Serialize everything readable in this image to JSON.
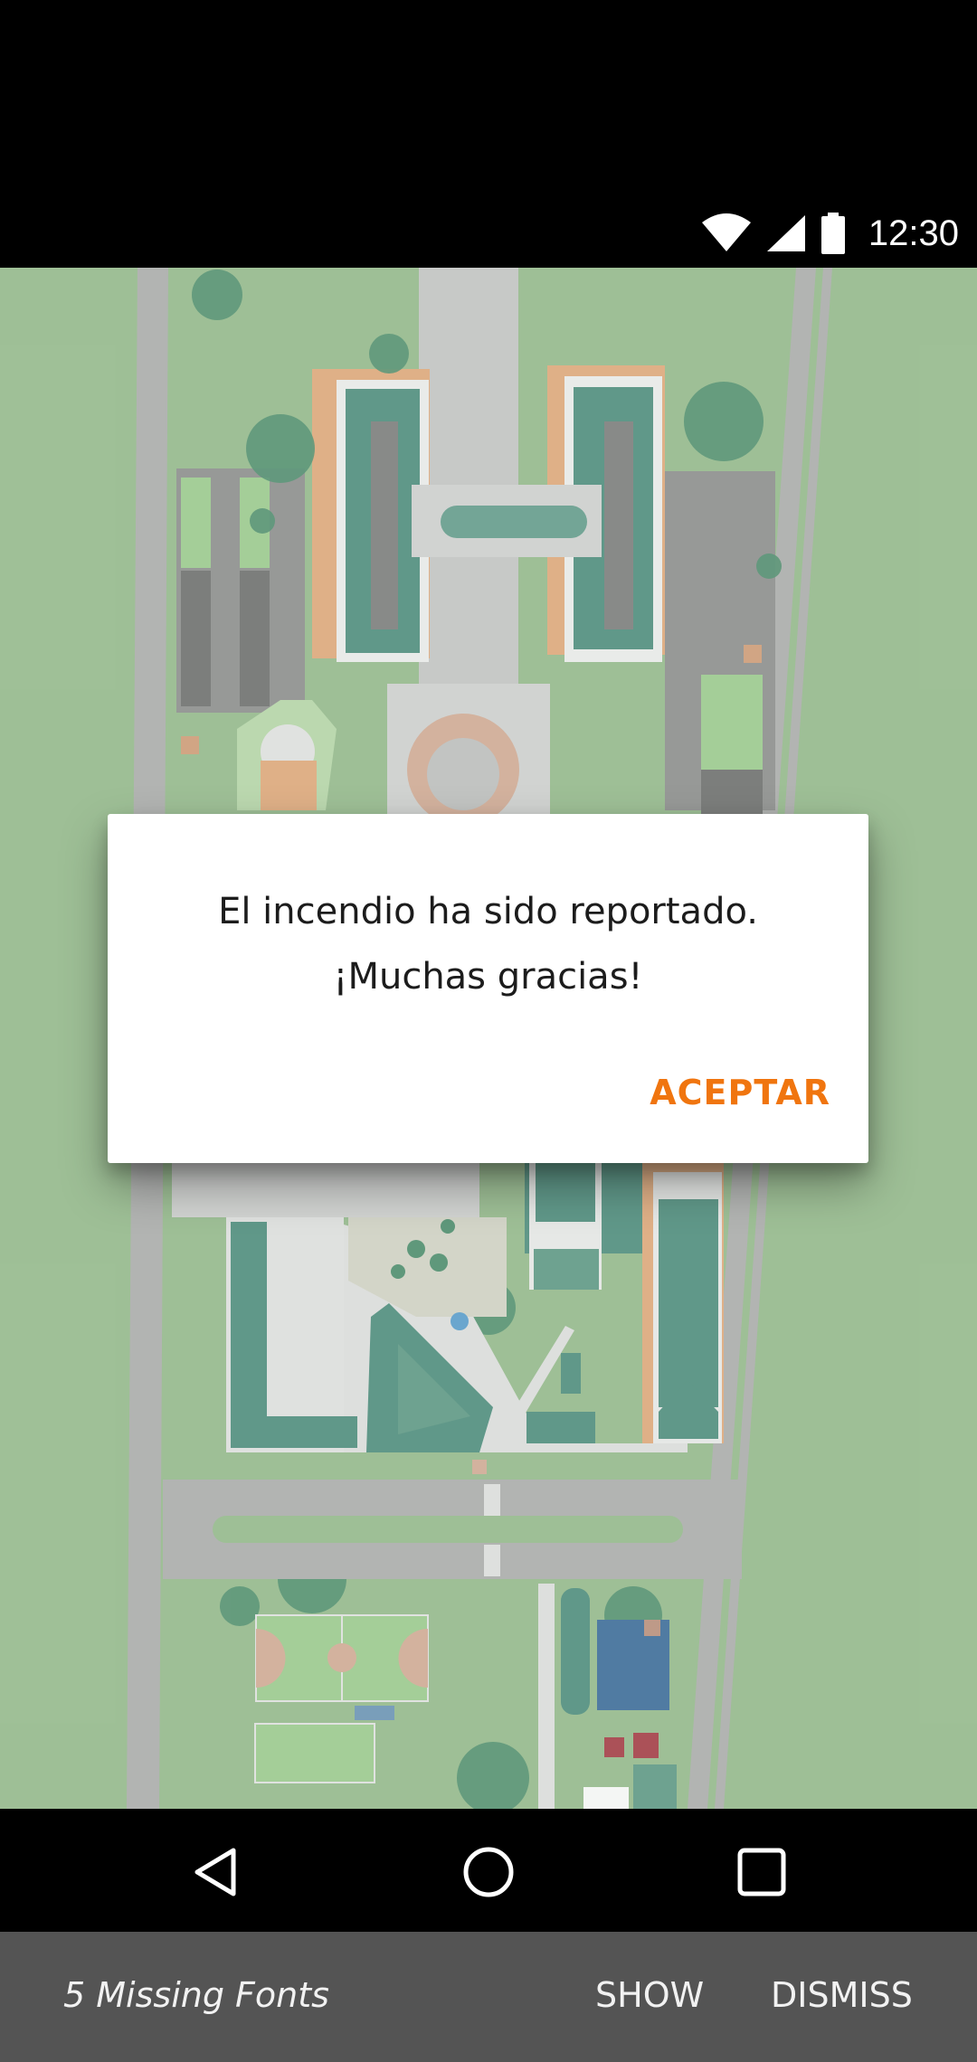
{
  "status_bar": {
    "time": "12:30",
    "icons": [
      "wifi-icon",
      "cell-signal-icon",
      "battery-icon"
    ]
  },
  "map": {
    "description_icon": "campus-map"
  },
  "dialog": {
    "message_line1": "El incendio ha sido reportado.",
    "message_line2": "¡Muchas gracias!",
    "accept_label": "ACEPTAR",
    "accent_color": "#f0750f"
  },
  "nav_bar": {
    "buttons": [
      "back-icon",
      "home-icon",
      "recents-icon"
    ]
  },
  "snackbar": {
    "text": "5 Missing Fonts",
    "show_label": "SHOW",
    "dismiss_label": "DISMISS"
  }
}
